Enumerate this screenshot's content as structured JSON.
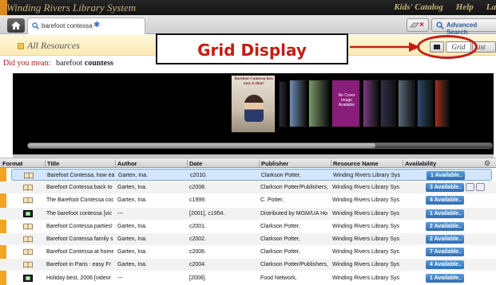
{
  "header": {
    "site_title": "Winding Rivers Library System",
    "links": [
      "Kids' Catalog",
      "Help",
      "La"
    ]
  },
  "tabs": {
    "search_tab_label": "barefoot contessa",
    "advanced_search": "Advanced Search"
  },
  "results_header": {
    "label": "All Resources"
  },
  "did_you_mean": {
    "prefix": "Did you mean:",
    "suggestion_plain": "barefoot",
    "suggestion_bold": "countess"
  },
  "annotation": {
    "text": "Grid Display"
  },
  "view_toggle": {
    "grid_label": "Grid",
    "list_label": "List",
    "selected": "Grid"
  },
  "carousel": {
    "covers": [
      {
        "kind": "photo",
        "caption": "Barefoot Contessa how easy is that?",
        "color": "#cfc3b0"
      },
      {
        "kind": "book",
        "color": "#2a2a3a"
      },
      {
        "kind": "book",
        "color": "#6f8fb8"
      },
      {
        "kind": "book",
        "color": "#7a9a6a"
      },
      {
        "kind": "text",
        "caption": "No Cover Image Available",
        "color": "#8a1c7a"
      },
      {
        "kind": "book",
        "color": "#7a3b80"
      },
      {
        "kind": "book",
        "color": "#2f2f4a"
      },
      {
        "kind": "book",
        "color": "#5a6a7a"
      },
      {
        "kind": "book",
        "color": "#2a4a6a"
      },
      {
        "kind": "book",
        "color": "#a03020"
      }
    ]
  },
  "table": {
    "columns": [
      "Format",
      "Title",
      "Author",
      "Date",
      "Publisher",
      "Resource Name",
      "Availability"
    ],
    "rows": [
      {
        "format": "book",
        "title": "Barefoot Contessa, how ea",
        "author": "Garten, Ina.",
        "date": "c2010.",
        "publisher": "Clarkson Potter,",
        "resource": "Winding Rivers Library Sys",
        "availability": "1 Available..",
        "selected": true
      },
      {
        "format": "book",
        "title": "Barefoot Contessa back to",
        "author": "Garten, Ina.",
        "date": "c2008.",
        "publisher": "Clarkson Potter/Publishers,",
        "resource": "Winding Rivers Library Sys",
        "availability": "3 Available..",
        "selected": false
      },
      {
        "format": "book",
        "title": "The Barefoot Contessa coo",
        "author": "Garten, Ina.",
        "date": "c1999.",
        "publisher": "C. Potter,",
        "resource": "Winding Rivers Library Sys",
        "availability": "4 Available..",
        "selected": false
      },
      {
        "format": "video",
        "title": "The barefoot contessa [vic",
        "author": "---",
        "date": "[2001], c1954.",
        "publisher": "Distributed by MGM/UA Ho",
        "resource": "Winding Rivers Library Sys",
        "availability": "1 Available..",
        "selected": false
      },
      {
        "format": "book",
        "title": "Barefoot Contessa parties!",
        "author": "Garten, Ina.",
        "date": "c2001.",
        "publisher": "Clarkson Potter,",
        "resource": "Winding Rivers Library Sys",
        "availability": "2 Available..",
        "selected": false
      },
      {
        "format": "book",
        "title": "Barefoot Contessa family s",
        "author": "Garten, Ina.",
        "date": "c2002.",
        "publisher": "Clarkson Potter,",
        "resource": "Winding Rivers Library Sys",
        "availability": "2 Available..",
        "selected": false
      },
      {
        "format": "book",
        "title": "Barefoot Contessa at home",
        "author": "Garten, Ina.",
        "date": "c2006.",
        "publisher": "Clarkson Potter,",
        "resource": "Winding Rivers Library Sys",
        "availability": "7 Available..",
        "selected": false
      },
      {
        "format": "book",
        "title": "Barefoot in Paris : easy Fr",
        "author": "Garten, Ina.",
        "date": "c2004.",
        "publisher": "Clarkson Potter/Publishers,",
        "resource": "Winding Rivers Library Sys",
        "availability": "4 Available..",
        "selected": false
      },
      {
        "format": "video",
        "title": "Holiday best, 2006 [videor",
        "author": "---",
        "date": "[2006].",
        "publisher": "Food Network,",
        "resource": "Winding Rivers Library Sys",
        "availability": "1 Available..",
        "selected": false
      }
    ]
  },
  "colors": {
    "accent_orange": "#e0881a",
    "annotation_red": "#c41d12",
    "available_blue": "#2f6db4"
  }
}
